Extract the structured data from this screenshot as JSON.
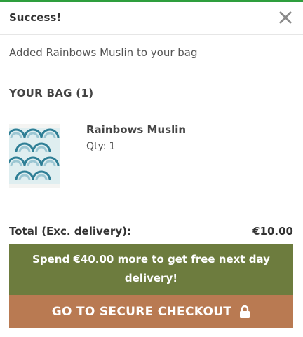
{
  "header": {
    "title": "Success!"
  },
  "message": "Added Rainbows Muslin to your bag",
  "bag": {
    "heading": "YOUR BAG (1)",
    "items": [
      {
        "name": "Rainbows Muslin",
        "qty_label": "Qty:",
        "qty": "1",
        "image_icon": "product-thumbnail"
      }
    ]
  },
  "totals": {
    "label": "Total (Exc. delivery):",
    "value": "€10.00"
  },
  "promo": {
    "prefix": "Spend",
    "amount": "€40.00",
    "suffix_line1": "more to get free next day",
    "suffix_line2": "delivery!"
  },
  "checkout": {
    "label": "GO TO SECURE CHECKOUT",
    "icon": "lock-icon"
  },
  "colors": {
    "accent": "#2e9e3e",
    "promo_bg": "#6d7c3e",
    "checkout_bg": "#b97a52"
  }
}
